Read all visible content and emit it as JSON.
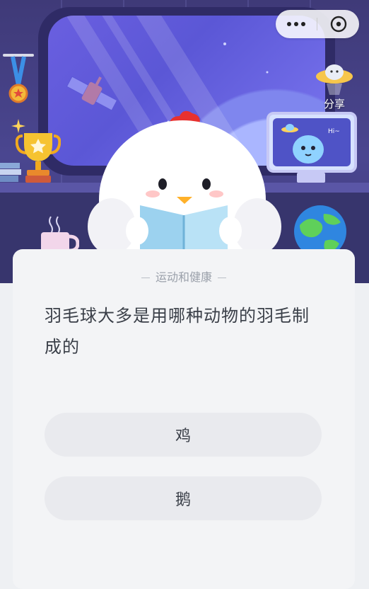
{
  "header": {
    "menu_icon": "more-dots-icon",
    "close_icon": "close-circle-icon",
    "share_label": "分享"
  },
  "quiz": {
    "category": "运动和健康",
    "question": "羽毛球大多是用哪种动物的羽毛制成的",
    "options": [
      {
        "label": "鸡"
      },
      {
        "label": "鹅"
      }
    ]
  },
  "monitor": {
    "greeting": "Hi~"
  },
  "colors": {
    "scene_bg": "#3f3a78",
    "card_bg": "#f3f4f6",
    "option_bg": "#e9eaee",
    "text_primary": "#3a3f48",
    "text_muted": "#9aa0aa",
    "comb_red": "#e8312e"
  }
}
